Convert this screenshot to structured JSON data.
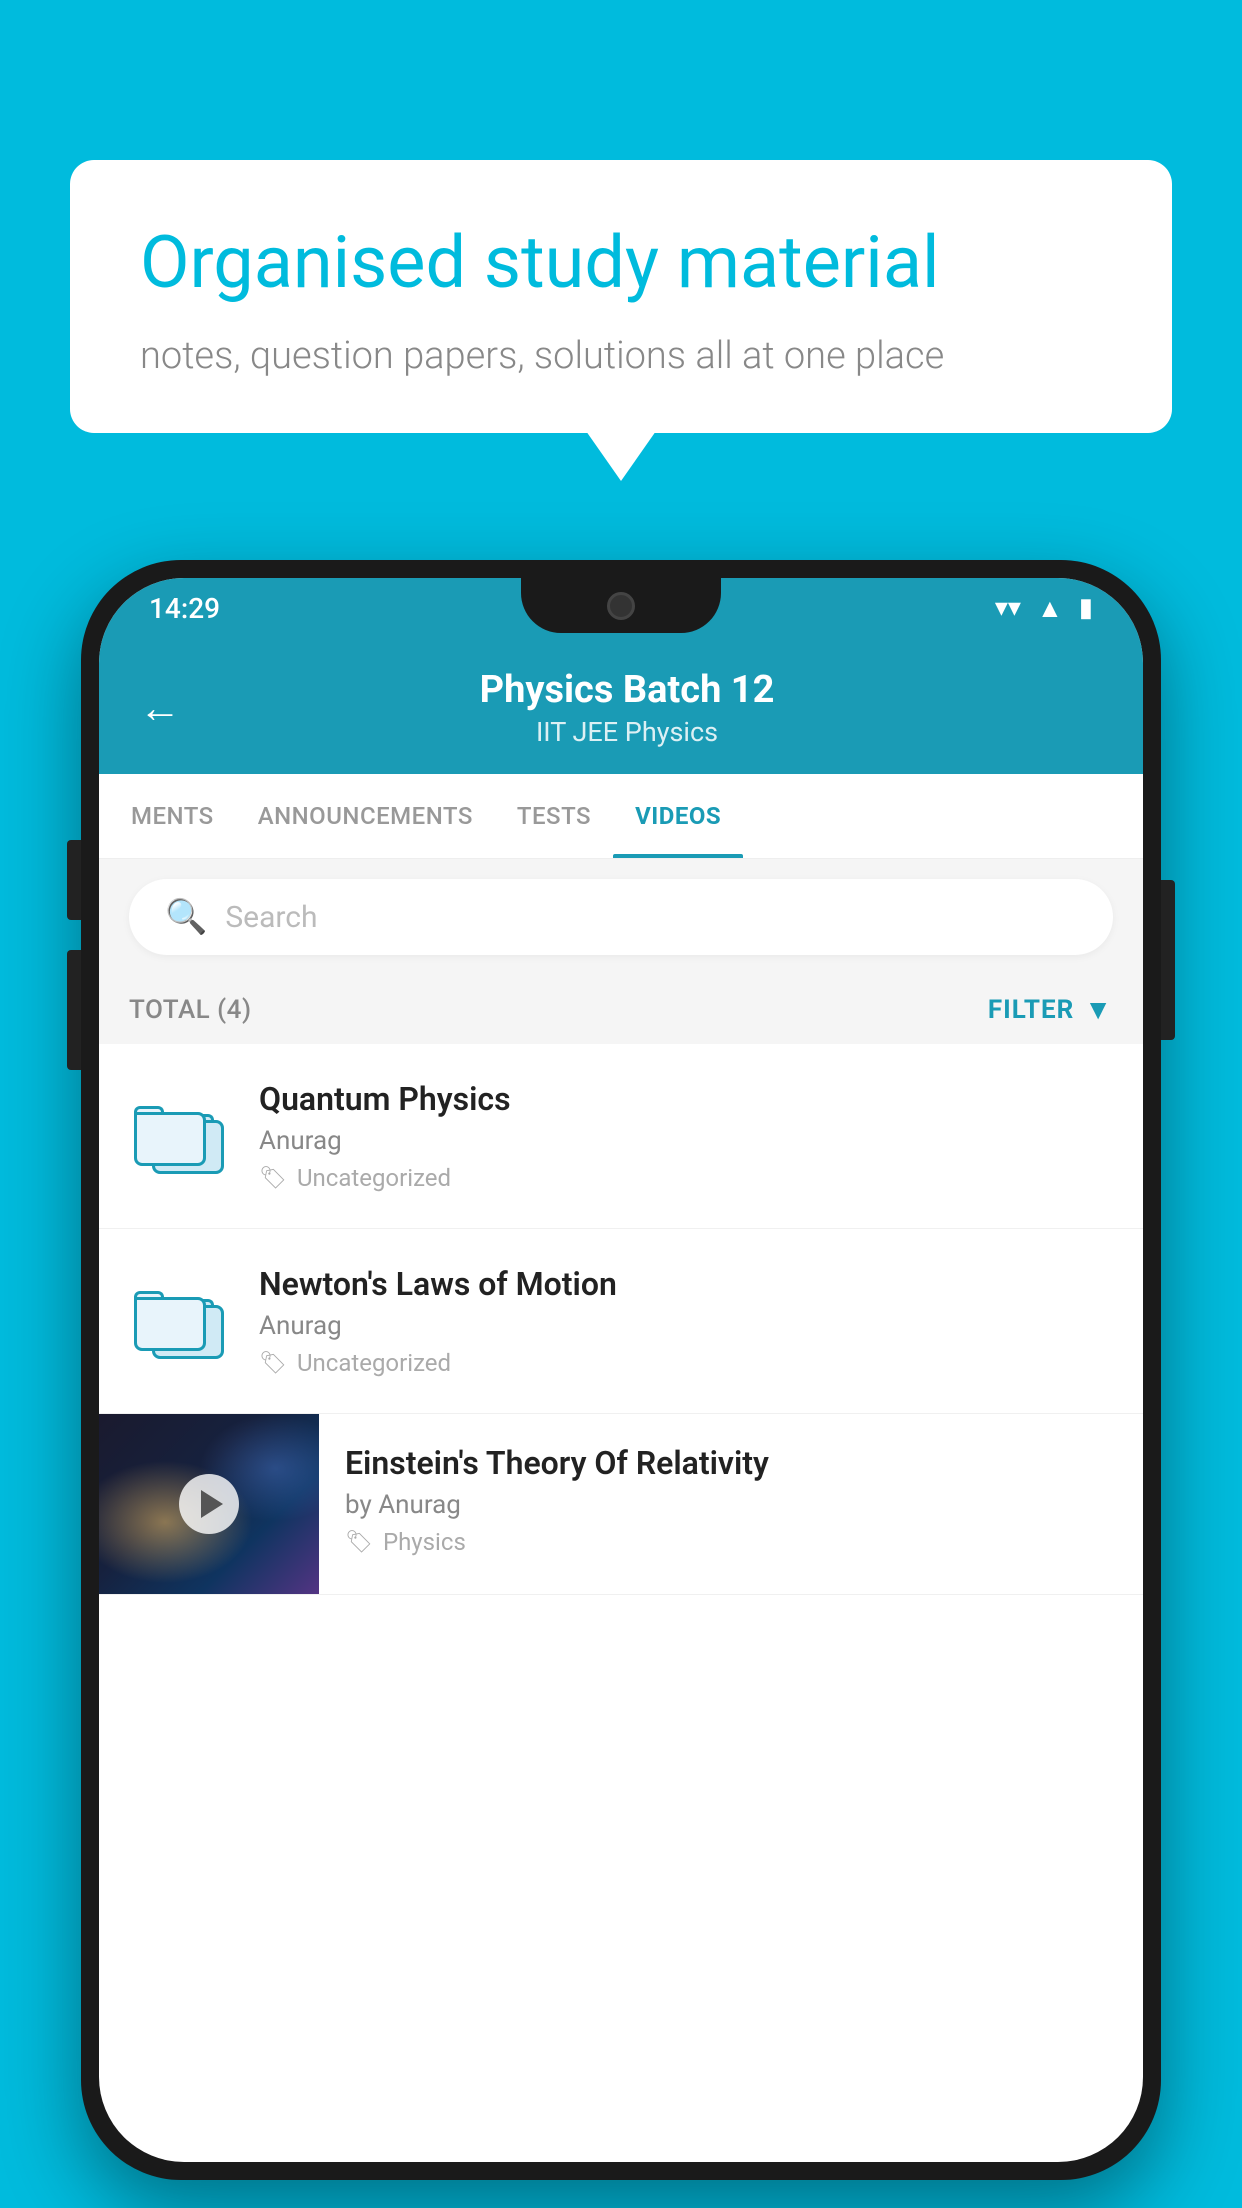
{
  "background_color": "#00BBDD",
  "speech_bubble": {
    "heading": "Organised study material",
    "subtext": "notes, question papers, solutions all at one place"
  },
  "phone": {
    "status_bar": {
      "time": "14:29",
      "wifi": "▼",
      "signal": "▲",
      "battery": "▮"
    },
    "header": {
      "title": "Physics Batch 12",
      "subtitle": "IIT JEE   Physics",
      "back_label": "←"
    },
    "tabs": [
      {
        "label": "MENTS",
        "active": false
      },
      {
        "label": "ANNOUNCEMENTS",
        "active": false
      },
      {
        "label": "TESTS",
        "active": false
      },
      {
        "label": "VIDEOS",
        "active": true
      }
    ],
    "search": {
      "placeholder": "Search"
    },
    "filter_bar": {
      "total_label": "TOTAL (4)",
      "filter_label": "FILTER"
    },
    "items": [
      {
        "title": "Quantum Physics",
        "author": "Anurag",
        "tag": "Uncategorized",
        "type": "folder"
      },
      {
        "title": "Newton's Laws of Motion",
        "author": "Anurag",
        "tag": "Uncategorized",
        "type": "folder"
      },
      {
        "title": "Einstein's Theory Of Relativity",
        "author": "by Anurag",
        "tag": "Physics",
        "type": "video"
      }
    ]
  }
}
